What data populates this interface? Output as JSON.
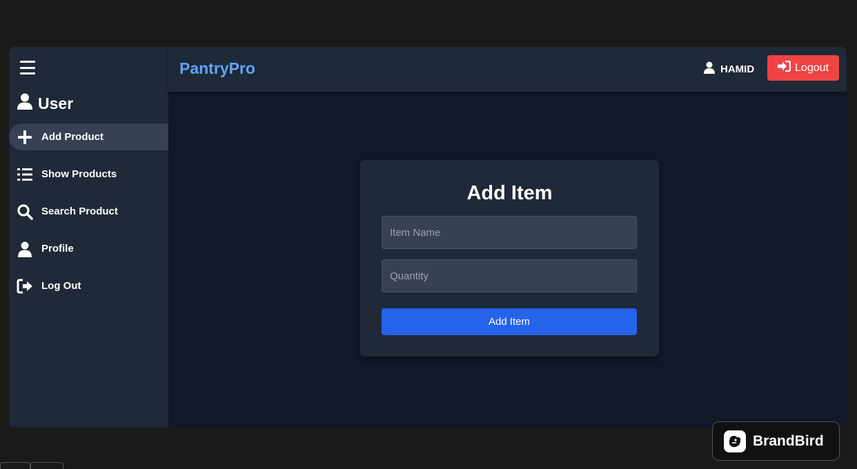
{
  "header": {
    "brand": "PantryPro",
    "username": "HAMID",
    "logout_label": "Logout"
  },
  "sidebar": {
    "title": "User",
    "items": [
      {
        "label": "Add Product",
        "icon": "plus-icon",
        "active": true
      },
      {
        "label": "Show Products",
        "icon": "list-icon",
        "active": false
      },
      {
        "label": "Search Product",
        "icon": "search-icon",
        "active": false
      },
      {
        "label": "Profile",
        "icon": "user-icon",
        "active": false
      },
      {
        "label": "Log Out",
        "icon": "sign-out-icon",
        "active": false
      }
    ]
  },
  "form": {
    "title": "Add Item",
    "item_name_placeholder": "Item Name",
    "item_name_value": "",
    "quantity_placeholder": "Quantity",
    "quantity_value": "",
    "submit_label": "Add Item"
  },
  "watermark": {
    "label": "BrandBird"
  },
  "colors": {
    "brand": "#60a5fa",
    "logout": "#ef4444",
    "primary": "#2563eb",
    "sidebar_bg": "#1f2937",
    "main_bg": "#111827",
    "active_item": "#374151"
  }
}
